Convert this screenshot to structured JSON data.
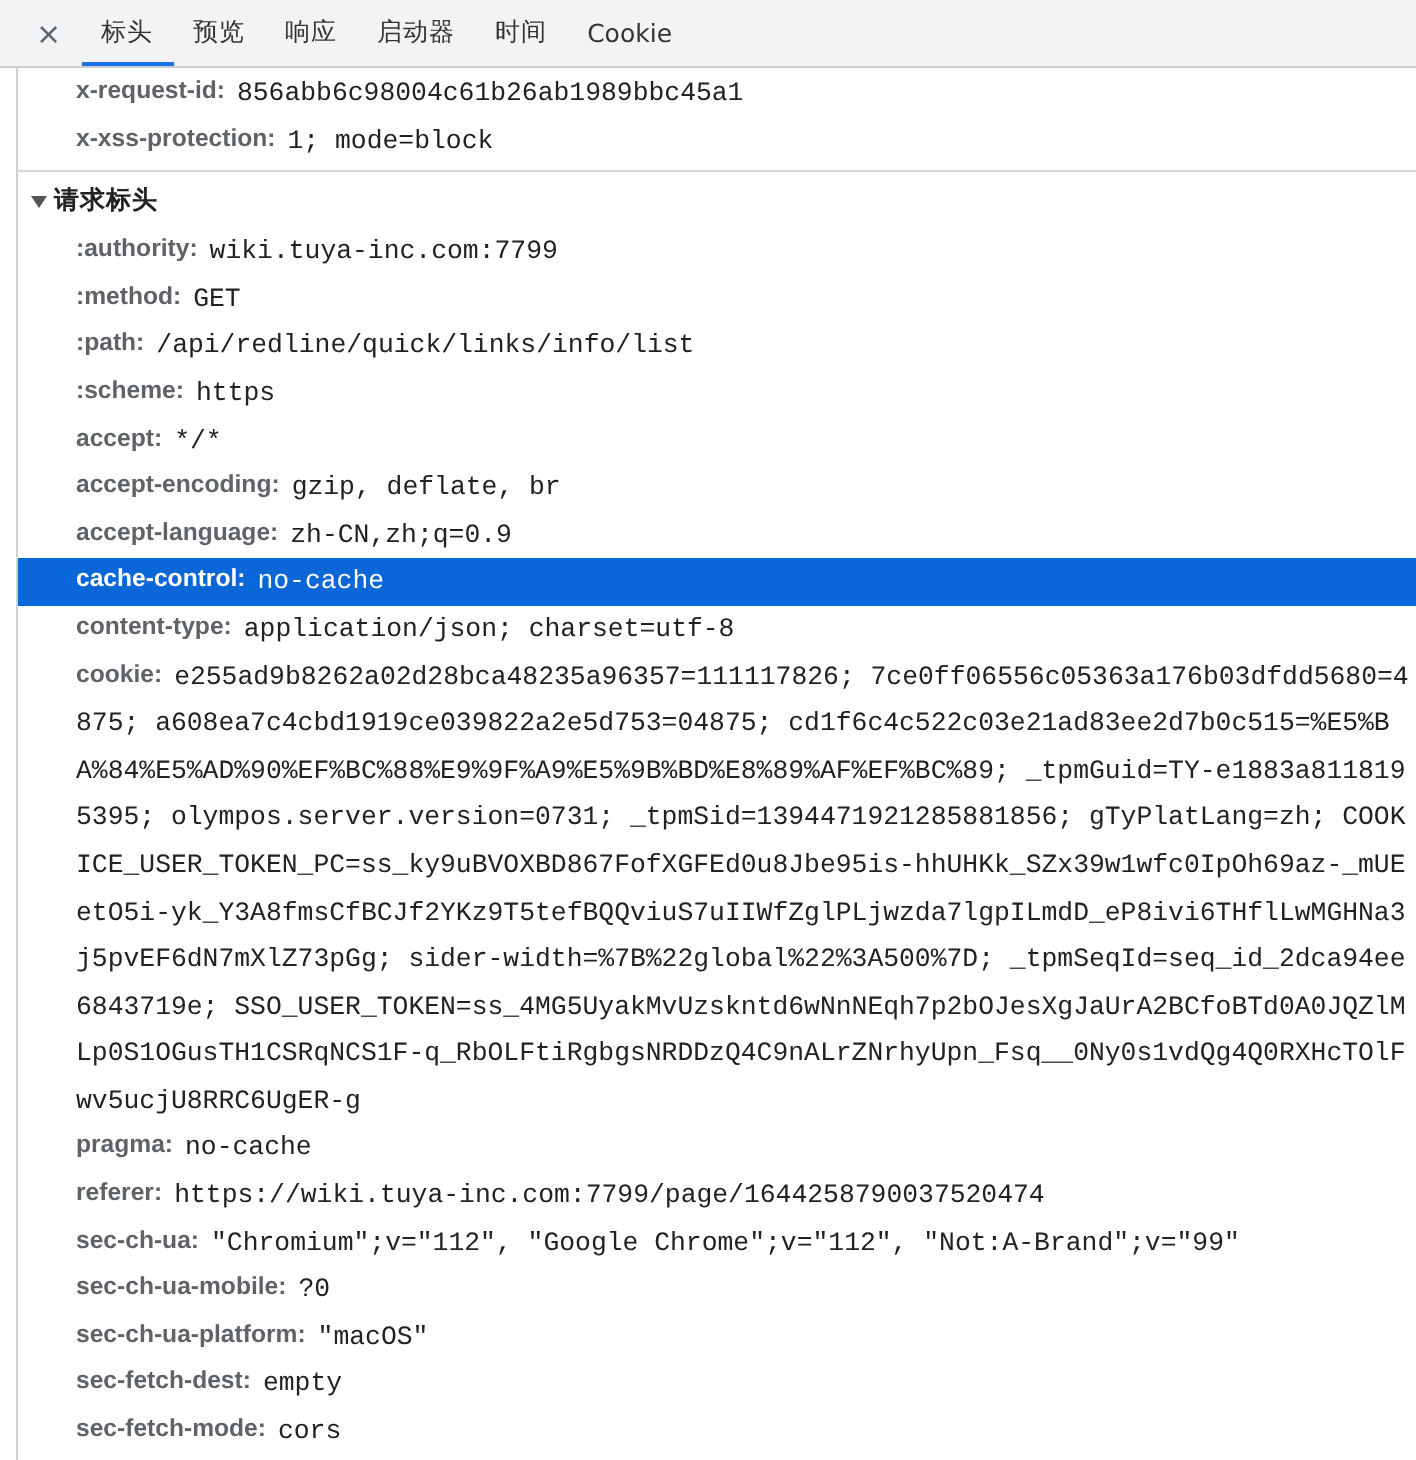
{
  "toolbar": {
    "close_button": "×",
    "tabs": [
      {
        "label": "标头",
        "selected": true
      },
      {
        "label": "预览",
        "selected": false
      },
      {
        "label": "响应",
        "selected": false
      },
      {
        "label": "启动器",
        "selected": false
      },
      {
        "label": "时间",
        "selected": false
      },
      {
        "label": "Cookie",
        "selected": false
      }
    ]
  },
  "sections": [
    {
      "headers": [
        {
          "name": "x-request-id:",
          "value": "856abb6c98004c61b26ab1989bbc45a1",
          "selected": false
        },
        {
          "name": "x-xss-protection:",
          "value": "1; mode=block",
          "selected": false
        }
      ]
    },
    {
      "title": "请求标头",
      "expanded": true,
      "headers": [
        {
          "name": ":authority:",
          "value": "wiki.tuya-inc.com:7799",
          "selected": false
        },
        {
          "name": ":method:",
          "value": "GET",
          "selected": false
        },
        {
          "name": ":path:",
          "value": "/api/redline/quick/links/info/list",
          "selected": false
        },
        {
          "name": ":scheme:",
          "value": "https",
          "selected": false
        },
        {
          "name": "accept:",
          "value": "*/*",
          "selected": false
        },
        {
          "name": "accept-encoding:",
          "value": "gzip, deflate, br",
          "selected": false
        },
        {
          "name": "accept-language:",
          "value": "zh-CN,zh;q=0.9",
          "selected": false
        },
        {
          "name": "cache-control:",
          "value": "no-cache",
          "selected": true
        },
        {
          "name": "content-type:",
          "value": "application/json; charset=utf-8",
          "selected": false
        },
        {
          "name": "cookie:",
          "value": "e255ad9b8262a02d28bca48235a96357=111117826; 7ce0ff06556c05363a176b03dfdd5680=4875; a608ea7c4cbd1919ce039822a2e5d753=04875; cd1f6c4c522c03e21ad83ee2d7b0c515=%E5%BA%84%E5%AD%90%EF%BC%88%E9%9F%A9%E5%9B%BD%E8%89%AF%EF%BC%89; _tpmGuid=TY-e1883a8118195395; olympos.server.version=0731; _tpmSid=1394471921285881856; gTyPlatLang=zh; COOKICE_USER_TOKEN_PC=ss_ky9uBVOXBD867FofXGFEd0u8Jbe95is-hhUHKk_SZx39w1wfc0IpOh69az-_mUEetO5i-yk_Y3A8fmsCfBCJf2YKz9T5tefBQQviuS7uIIWfZglPLjwzda7lgpILmdD_eP8ivi6THflLwMGHNa3j5pvEF6dN7mXlZ73pGg; sider-width=%7B%22global%22%3A500%7D; _tpmSeqId=seq_id_2dca94ee6843719e; SSO_USER_TOKEN=ss_4MG5UyakMvUzskntd6wNnNEqh7p2bOJesXgJaUrA2BCfoBTd0A0JQZlMLp0S1OGusTH1CSRqNCS1F-q_RbOLFtiRgbgsNRDDzQ4C9nALrZNrhyUpn_Fsq__0Ny0s1vdQg4Q0RXHcTOlFwv5ucjU8RRC6UgER-g",
          "selected": false
        },
        {
          "name": "pragma:",
          "value": "no-cache",
          "selected": false
        },
        {
          "name": "referer:",
          "value": "https://wiki.tuya-inc.com:7799/page/1644258790037520474",
          "selected": false
        },
        {
          "name": "sec-ch-ua:",
          "value": "\"Chromium\";v=\"112\", \"Google Chrome\";v=\"112\", \"Not:A-Brand\";v=\"99\"",
          "selected": false
        },
        {
          "name": "sec-ch-ua-mobile:",
          "value": "?0",
          "selected": false
        },
        {
          "name": "sec-ch-ua-platform:",
          "value": "\"macOS\"",
          "selected": false
        },
        {
          "name": "sec-fetch-dest:",
          "value": "empty",
          "selected": false
        },
        {
          "name": "sec-fetch-mode:",
          "value": "cors",
          "selected": false
        }
      ]
    }
  ]
}
